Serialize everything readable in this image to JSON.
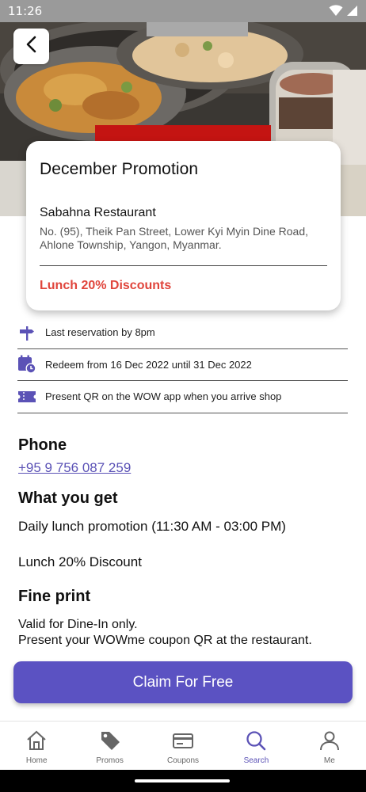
{
  "status_bar": {
    "time": "11:26",
    "icons": [
      "wifi-icon",
      "signal-icon"
    ]
  },
  "header": {
    "back_icon": "chevron-left-icon"
  },
  "promo_card": {
    "title": "December Promotion",
    "restaurant_name": "Sabahna Restaurant",
    "address": "No. (95), Theik Pan Street, Lower Kyi Myin Dine Road, Ahlone Township, Yangon, Myanmar.",
    "discount": "Lunch 20% Discounts"
  },
  "info_items": [
    {
      "icon": "signpost-icon",
      "text": "Last reservation by 8pm"
    },
    {
      "icon": "calendar-clock-icon",
      "text": "Redeem from 16 Dec 2022 until 31 Dec 2022"
    },
    {
      "icon": "ticket-icon",
      "text": "Present QR on the WOW app when you arrive shop"
    }
  ],
  "phone": {
    "heading": "Phone",
    "number": "+95 9 756 087 259"
  },
  "what_you_get": {
    "heading": "What you get",
    "lines": [
      "Daily lunch promotion (11:30 AM - 03:00 PM)",
      "Lunch 20% Discount"
    ]
  },
  "fine_print": {
    "heading": "Fine print",
    "lines": [
      "Valid for Dine-In only.",
      "Present your WOWme coupon QR at the restaurant."
    ]
  },
  "claim_button": {
    "label": "Claim For Free"
  },
  "bottom_nav": {
    "items": [
      {
        "label": "Home",
        "icon": "home-icon"
      },
      {
        "label": "Promos",
        "icon": "tag-icon"
      },
      {
        "label": "Coupons",
        "icon": "coupon-card-icon"
      },
      {
        "label": "Search",
        "icon": "search-icon"
      },
      {
        "label": "Me",
        "icon": "person-icon"
      }
    ],
    "active": "Search"
  },
  "colors": {
    "accent": "#5b52c2",
    "discount": "#e0453c",
    "link": "#5b52b6"
  }
}
